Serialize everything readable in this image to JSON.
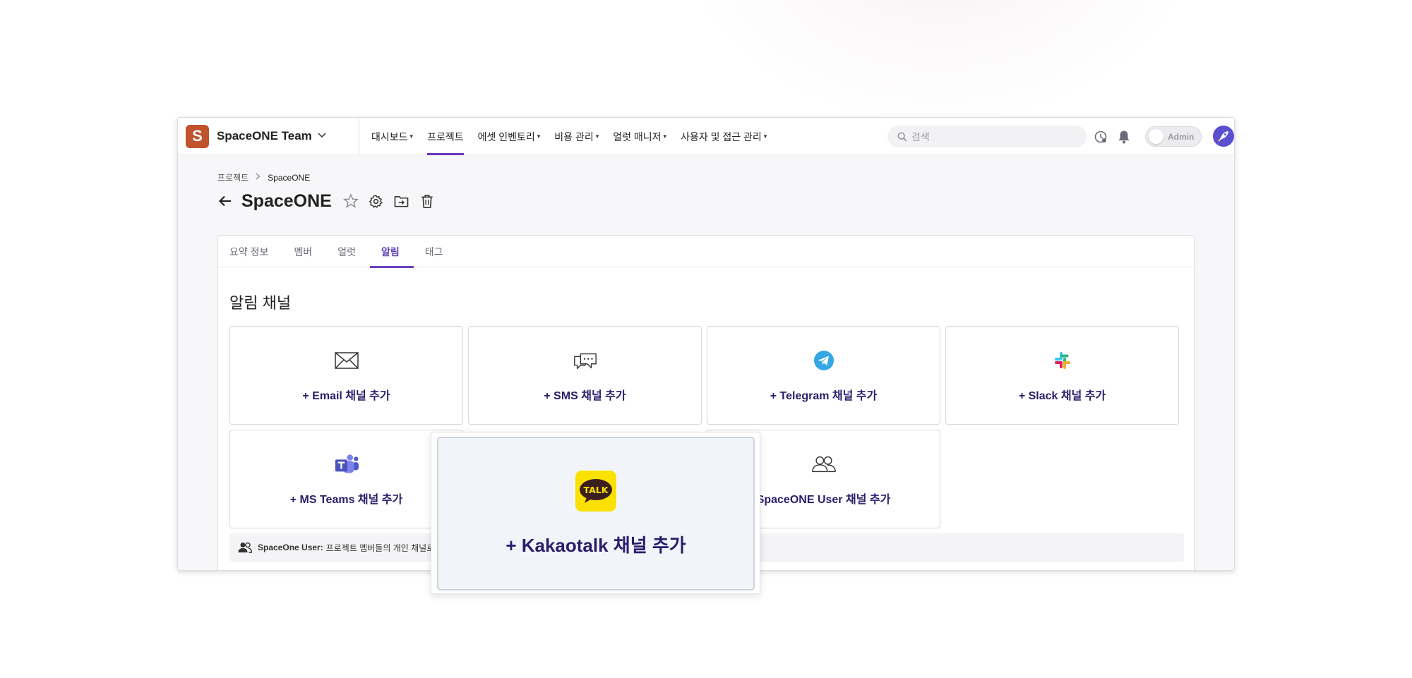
{
  "workspace": {
    "logo_letter": "S",
    "name": "SpaceONE Team"
  },
  "menu": [
    {
      "label": "대시보드",
      "has_dropdown": true,
      "active": false
    },
    {
      "label": "프로젝트",
      "has_dropdown": false,
      "active": true
    },
    {
      "label": "에셋 인벤토리",
      "has_dropdown": true,
      "active": false
    },
    {
      "label": "비용 관리",
      "has_dropdown": true,
      "active": false
    },
    {
      "label": "얼럿 매니저",
      "has_dropdown": true,
      "active": false
    },
    {
      "label": "사용자 및 접근 관리",
      "has_dropdown": true,
      "active": false
    }
  ],
  "search": {
    "placeholder": "검색",
    "value": ""
  },
  "toggle": {
    "label": "Admin",
    "on": false
  },
  "breadcrumb": {
    "parent": "프로젝트",
    "current": "SpaceONE"
  },
  "page": {
    "title": "SpaceONE"
  },
  "tabs": [
    {
      "label": "요약 정보",
      "active": false
    },
    {
      "label": "멤버",
      "active": false
    },
    {
      "label": "얼럿",
      "active": false
    },
    {
      "label": "알림",
      "active": true
    },
    {
      "label": "태그",
      "active": false
    }
  ],
  "section": {
    "title": "알림 채널"
  },
  "channels": {
    "email": {
      "label": "+ Email 채널 추가",
      "icon": "mail-icon"
    },
    "sms": {
      "label": "+ SMS 채널 추가",
      "icon": "chat-bubbles-icon"
    },
    "telegram": {
      "label": "+ Telegram 채널 추가",
      "icon": "telegram-icon"
    },
    "slack": {
      "label": "+ Slack 채널 추가",
      "icon": "slack-icon"
    },
    "msteams": {
      "label": "+ MS Teams 채널 추가",
      "icon": "ms-teams-icon"
    },
    "spaceone_user": {
      "label": "SpaceONE User 채널 추가",
      "icon": "users-icon"
    }
  },
  "info": {
    "label": "SpaceOne User:",
    "text": "프로젝트 멤버들의 개인 채널로"
  },
  "popout": {
    "label": "+ Kakaotalk 채널 추가",
    "icon_text": "TALK"
  },
  "colors": {
    "accent": "#6638b6",
    "link": "#2b1d6b",
    "workspace_logo": "#c0522c",
    "kakao": "#fae100"
  }
}
